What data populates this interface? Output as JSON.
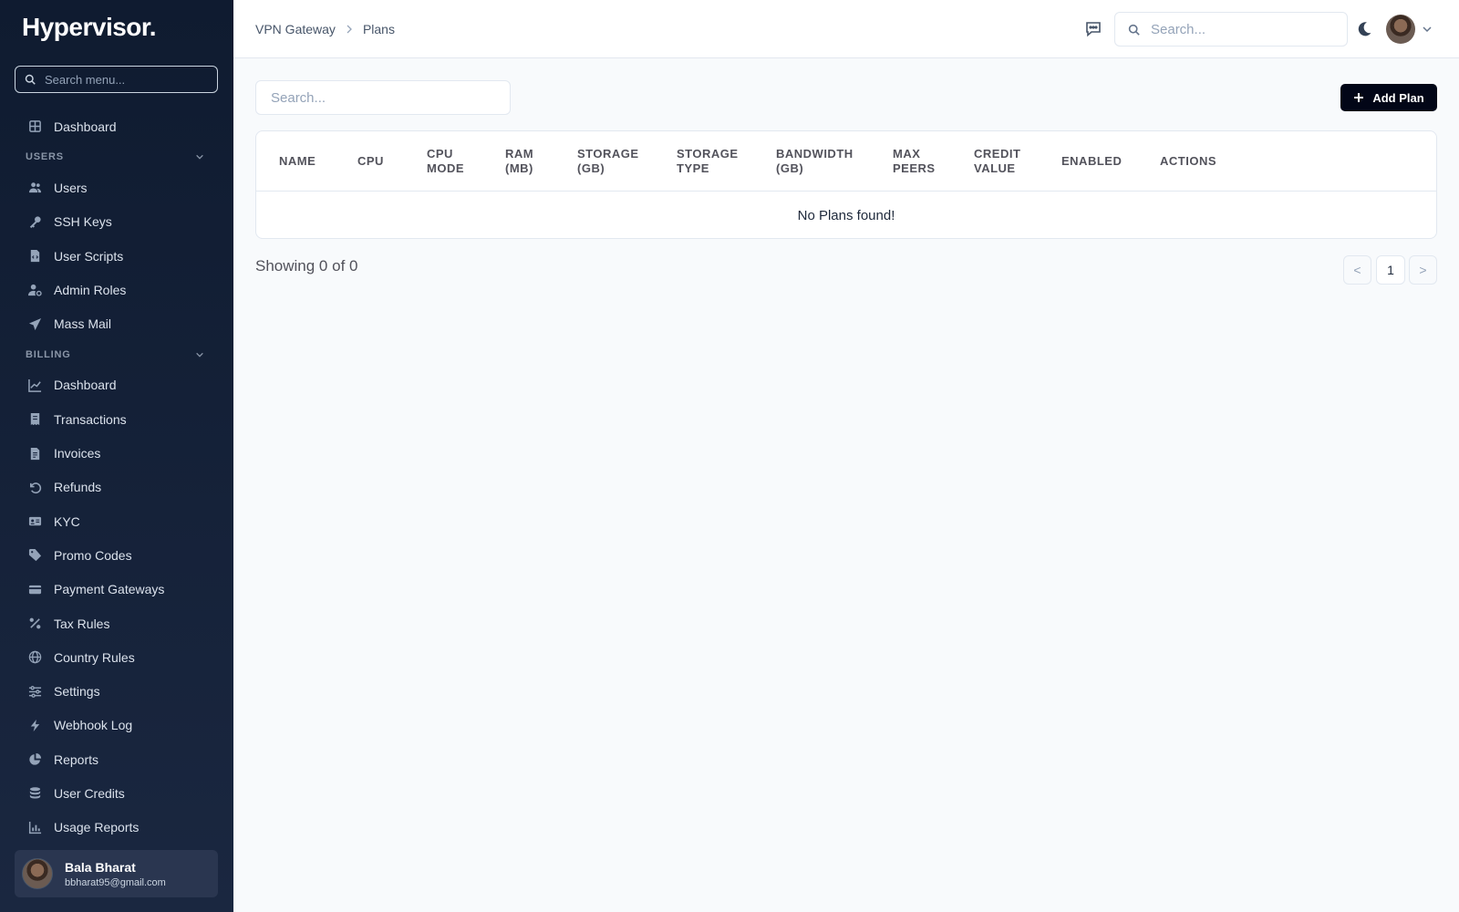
{
  "app": {
    "logo": "Hypervisor."
  },
  "sidebar": {
    "search_placeholder": "Search menu...",
    "top_item": {
      "label": "Dashboard",
      "icon": "grid-icon"
    },
    "sections": [
      {
        "title": "USERS",
        "items": [
          {
            "label": "Users",
            "icon": "users-icon"
          },
          {
            "label": "SSH Keys",
            "icon": "key-icon"
          },
          {
            "label": "User Scripts",
            "icon": "file-code-icon"
          },
          {
            "label": "Admin Roles",
            "icon": "user-cog-icon"
          },
          {
            "label": "Mass Mail",
            "icon": "send-icon"
          }
        ]
      },
      {
        "title": "BILLING",
        "items": [
          {
            "label": "Dashboard",
            "icon": "chart-line-icon"
          },
          {
            "label": "Transactions",
            "icon": "receipt-icon"
          },
          {
            "label": "Invoices",
            "icon": "file-text-icon"
          },
          {
            "label": "Refunds",
            "icon": "undo-icon"
          },
          {
            "label": "KYC",
            "icon": "id-card-icon"
          },
          {
            "label": "Promo Codes",
            "icon": "tag-icon"
          },
          {
            "label": "Payment Gateways",
            "icon": "credit-card-icon"
          },
          {
            "label": "Tax Rules",
            "icon": "percent-icon"
          },
          {
            "label": "Country Rules",
            "icon": "globe-icon"
          },
          {
            "label": "Settings",
            "icon": "sliders-icon"
          },
          {
            "label": "Webhook Log",
            "icon": "bolt-icon"
          },
          {
            "label": "Reports",
            "icon": "pie-chart-icon"
          },
          {
            "label": "User Credits",
            "icon": "coins-icon"
          },
          {
            "label": "Usage Reports",
            "icon": "bar-chart-icon"
          }
        ]
      }
    ],
    "user": {
      "name": "Bala Bharat",
      "email": "bbharat95@gmail.com"
    }
  },
  "header": {
    "breadcrumb": [
      "VPN Gateway",
      "Plans"
    ],
    "search_placeholder": "Search..."
  },
  "main": {
    "search_placeholder": "Search...",
    "add_button": "Add Plan",
    "table": {
      "columns": [
        [
          "NAME"
        ],
        [
          "CPU"
        ],
        [
          "CPU",
          "MODE"
        ],
        [
          "RAM",
          "(MB)"
        ],
        [
          "STORAGE",
          "(GB)"
        ],
        [
          "STORAGE",
          "TYPE"
        ],
        [
          "BANDWIDTH",
          "(GB)"
        ],
        [
          "MAX",
          "PEERS"
        ],
        [
          "CREDIT",
          "VALUE"
        ],
        [
          "ENABLED"
        ],
        [
          "ACTIONS"
        ]
      ],
      "empty_message": "No Plans found!"
    },
    "showing": "Showing 0 of 0",
    "pagination": {
      "prev": "<",
      "current": "1",
      "next": ">"
    }
  },
  "colors": {
    "sidebar_bg": "#0f1b30",
    "primary_button": "#020617",
    "page_bg": "#f8fafc"
  }
}
